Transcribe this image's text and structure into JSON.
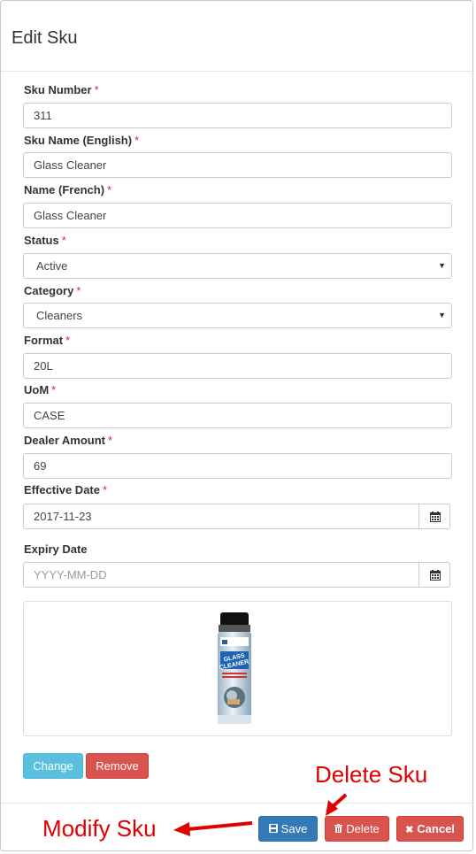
{
  "header": {
    "title": "Edit Sku"
  },
  "required_mark": "*",
  "fields": {
    "sku_number": {
      "label": "Sku Number",
      "value": "311"
    },
    "sku_name_en": {
      "label": "Sku Name (English)",
      "value": "Glass Cleaner"
    },
    "name_fr": {
      "label": "Name (French)",
      "value": "Glass Cleaner"
    },
    "status": {
      "label": "Status",
      "value": "Active"
    },
    "category": {
      "label": "Category",
      "value": "Cleaners"
    },
    "format": {
      "label": "Format",
      "value": "20L"
    },
    "uom": {
      "label": "UoM",
      "value": "CASE"
    },
    "dealer_amount": {
      "label": "Dealer Amount",
      "value": "69"
    },
    "effective_date": {
      "label": "Effective Date",
      "value": "2017-11-23"
    },
    "expiry_date": {
      "label": "Expiry Date",
      "placeholder": "YYYY-MM-DD"
    }
  },
  "image": {
    "product_label_top": "GLASS",
    "product_label_bottom": "CLEANER"
  },
  "image_buttons": {
    "change": "Change",
    "remove": "Remove"
  },
  "footer": {
    "save": "Save",
    "delete": "Delete",
    "cancel": "Cancel"
  },
  "annotations": {
    "delete": "Delete Sku",
    "modify": "Modify Sku"
  },
  "colors": {
    "primary": "#337ab7",
    "danger": "#d9534f",
    "info": "#5bc0de",
    "annotation": "#e00000"
  }
}
